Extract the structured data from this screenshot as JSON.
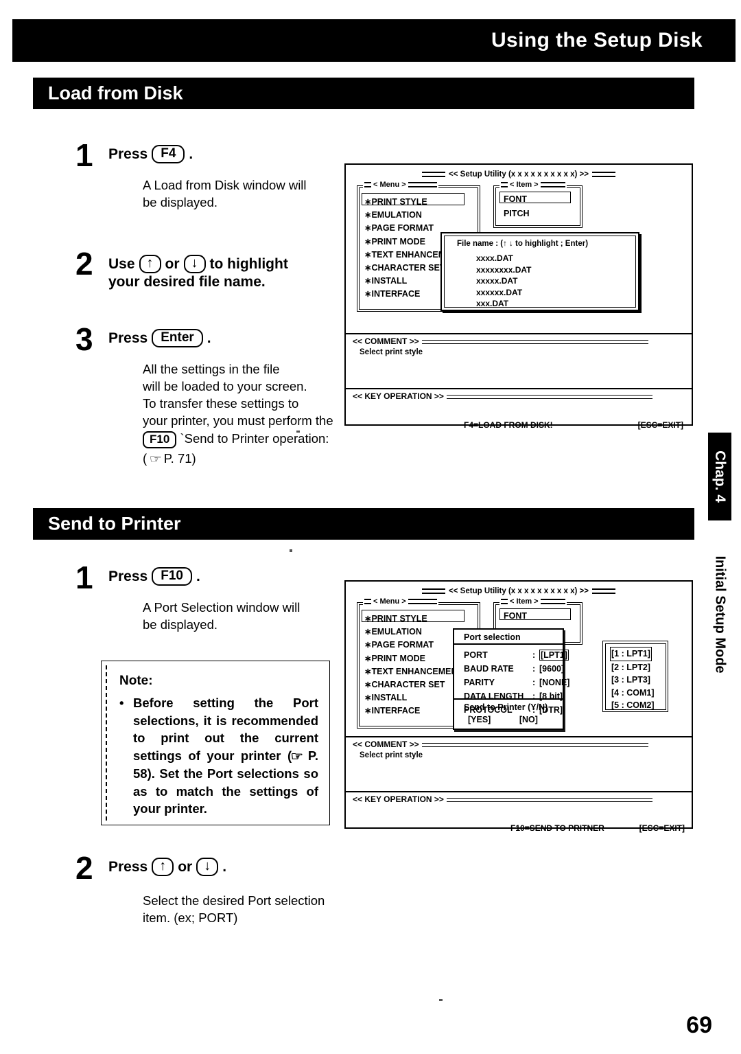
{
  "header": {
    "title": "Using the Setup Disk"
  },
  "sections": [
    {
      "id": "load",
      "title": "Load from Disk"
    },
    {
      "id": "send",
      "title": "Send to Printer"
    }
  ],
  "load_steps": [
    {
      "number": "1",
      "head_prefix": "Press",
      "key": "F4",
      "head_suffix": ".",
      "body": "A Load from Disk window will\nbe displayed."
    },
    {
      "number": "2",
      "head_prefix": "Use",
      "key_up": "↑",
      "head_mid": "or",
      "key_down": "↓",
      "head_suffix": "to highlight",
      "head_line2": "your desired file name."
    },
    {
      "number": "3",
      "head_prefix": "Press",
      "key": "Enter",
      "head_suffix": ".",
      "body_line1": "All the settings in the file",
      "body_line2": "will be loaded to your screen.",
      "body_line3": "To transfer these settings to",
      "body_line4": "your printer, you must perform the",
      "body_key": "F10",
      "body_line5": "`Send to Printer operation:",
      "body_line6_open": "(",
      "body_line6_ref": "P. 71)"
    }
  ],
  "send_steps": [
    {
      "number": "1",
      "head_prefix": "Press",
      "key": "F10",
      "head_suffix": ".",
      "body": "A Port Selection window will\nbe displayed."
    },
    {
      "number": "2",
      "head_prefix": "Press",
      "key_up": "↑",
      "head_mid": "or",
      "key_down": "↓",
      "head_suffix": ".",
      "body_line1": "Select the desired Port selection",
      "body_line2": "item. (ex;  PORT)"
    }
  ],
  "note": {
    "title": "Note:",
    "bullet_text": "Before setting the Port selections, it is recommended to print out the current settings of your printer (",
    "bullet_ref": "P. 58). Set the Port selections so as to match the settings of your printer."
  },
  "screen1": {
    "title": "<< Setup Utility (x x x x x x   x x x x) >>",
    "menu_label": "< Menu >",
    "menu_items": [
      "∗PRINT STYLE",
      "∗EMULATION",
      "∗PAGE FORMAT",
      "∗PRINT MODE",
      "∗TEXT ENHANCEMENT",
      "∗CHARACTER SET",
      "∗INSTALL",
      "∗INTERFACE"
    ],
    "item_label": "< Item >",
    "item_entries": [
      "FONT",
      "PITCH"
    ],
    "file_popup": {
      "header": "File name : (↑ ↓ to highlight ; Enter)",
      "files": [
        "xxxx.DAT",
        "xxxxxxxx.DAT",
        "xxxxx.DAT",
        "xxxxxx.DAT",
        "xxx.DAT"
      ]
    },
    "comment_label": "<<  COMMENT  >>",
    "comment_text": "Select print style",
    "keyop_label": "<<  KEY OPERATION  >>",
    "keyop_action": "F4=LOAD FROM DISK!",
    "keyop_exit": "[ESC=EXIT]"
  },
  "screen2": {
    "title": "<< Setup Utility (x x x x x x   x x x x) >>",
    "menu_label": "< Menu >",
    "menu_items": [
      "∗PRINT STYLE",
      "∗EMULATION",
      "∗PAGE FORMAT",
      "∗PRINT MODE",
      "∗TEXT ENHANCEMENT",
      "∗CHARACTER SET",
      "∗INSTALL",
      "∗INTERFACE"
    ],
    "item_label": "< Item >",
    "item_entries": [
      "FONT"
    ],
    "port_window": {
      "title": "Port selection",
      "rows": [
        {
          "key": "PORT",
          "value": "[LPT1]"
        },
        {
          "key": "BAUD RATE",
          "value": "[9600]"
        },
        {
          "key": "PARITY",
          "value": "[NONE]"
        },
        {
          "key": "DATA LENGTH",
          "value": "[8 bit]"
        },
        {
          "key": "PROTOCOL",
          "value": "[DTR]"
        }
      ],
      "send_prompt": "Send to Printer (Y/N)",
      "yes": "[YES]",
      "no": "[NO]"
    },
    "port_list": [
      "[1 : LPT1]",
      "[2 : LPT2]",
      "[3 : LPT3]",
      "[4 : COM1]",
      "[5 : COM2]"
    ],
    "comment_label": "<<  COMMENT  >>",
    "comment_text": "Select print style",
    "keyop_label": "<< KEY OPERATION  >>",
    "keyop_action": "F10=SEND TO PRITNER",
    "keyop_exit": "[ESC=EXIT]"
  },
  "chapter_tab": {
    "tab_label": "Chap. 4",
    "sub_label": "Initial Setup Mode"
  },
  "page_number": "69"
}
